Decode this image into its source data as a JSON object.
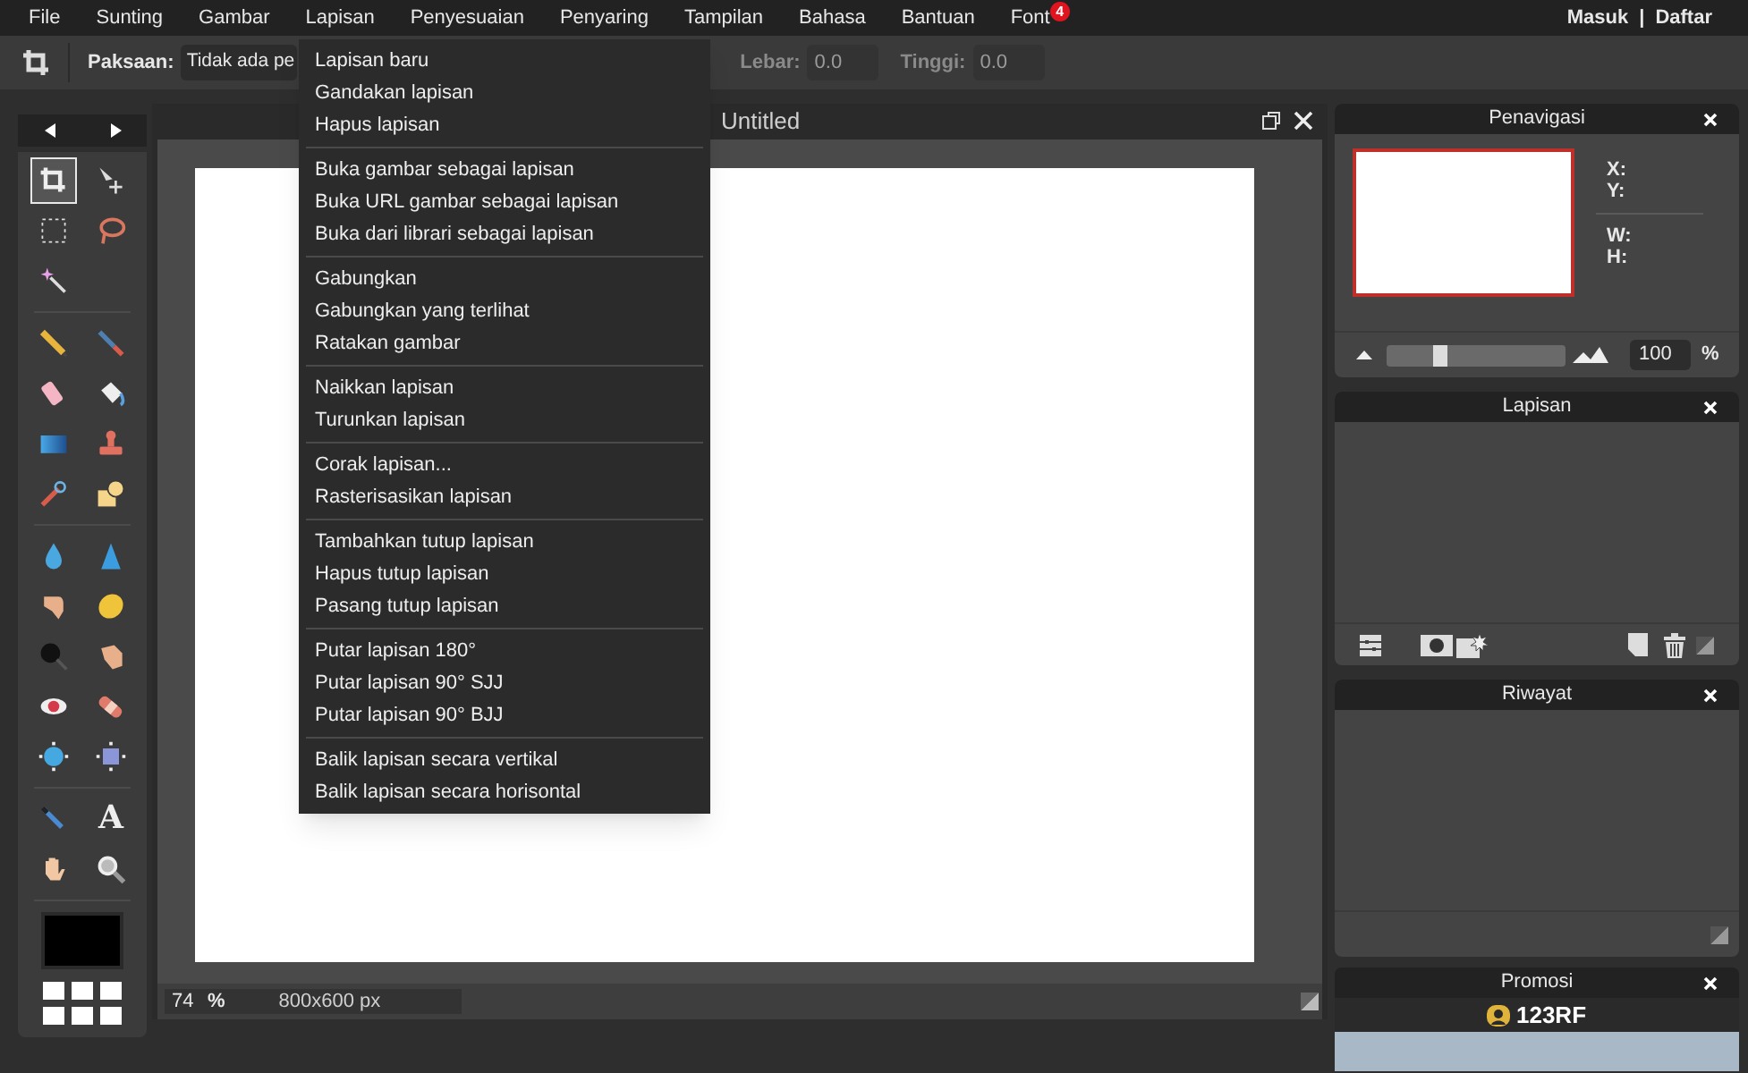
{
  "menu_bar": {
    "items": [
      {
        "label": "File"
      },
      {
        "label": "Sunting"
      },
      {
        "label": "Gambar"
      },
      {
        "label": "Lapisan"
      },
      {
        "label": "Penyesuaian"
      },
      {
        "label": "Penyaring"
      },
      {
        "label": "Tampilan"
      },
      {
        "label": "Bahasa"
      },
      {
        "label": "Bantuan"
      },
      {
        "label": "Font",
        "badge": "4"
      }
    ],
    "account": {
      "login": "Masuk",
      "separator": "|",
      "register": "Daftar"
    }
  },
  "options_bar": {
    "constraint_label": "Paksaan:",
    "constraint_value": "Tidak ada pe",
    "width_label": "Lebar:",
    "width_value": "0.0",
    "height_label": "Tinggi:",
    "height_value": "0.0"
  },
  "layer_menu": {
    "groups": [
      [
        "Lapisan baru",
        "Gandakan lapisan",
        "Hapus lapisan"
      ],
      [
        "Buka gambar sebagai lapisan",
        "Buka URL gambar sebagai lapisan",
        "Buka dari librari sebagai lapisan"
      ],
      [
        "Gabungkan",
        "Gabungkan yang terlihat",
        "Ratakan gambar"
      ],
      [
        "Naikkan lapisan",
        "Turunkan lapisan"
      ],
      [
        "Corak lapisan...",
        "Rasterisasikan lapisan"
      ],
      [
        "Tambahkan tutup lapisan",
        "Hapus tutup lapisan",
        "Pasang tutup lapisan"
      ],
      [
        "Putar lapisan 180°",
        "Putar lapisan 90° SJJ",
        "Putar lapisan 90° BJJ"
      ],
      [
        "Balik lapisan secara vertikal",
        "Balik lapisan secara horisontal"
      ]
    ]
  },
  "toolbox": {
    "groups": [
      [
        {
          "selected": true
        },
        {
          "selected": false
        },
        {
          "selected": false
        },
        {
          "selected": false
        },
        {
          "selected": false
        }
      ],
      [
        {
          "selected": false
        },
        {
          "selected": false
        },
        {
          "selected": false
        },
        {
          "selected": false
        },
        {
          "selected": false
        },
        {
          "selected": false
        },
        {
          "selected": false
        },
        {
          "selected": false
        }
      ],
      [
        {
          "selected": false
        },
        {
          "selected": false
        },
        {
          "selected": false
        },
        {
          "selected": false
        },
        {
          "selected": false
        },
        {
          "selected": false
        },
        {
          "selected": false
        },
        {
          "selected": false
        },
        {
          "selected": false
        },
        {
          "selected": false
        }
      ],
      [
        {
          "selected": false
        },
        {
          "selected": false,
          "glyph": "A"
        },
        {
          "selected": false
        },
        {
          "selected": false
        }
      ]
    ],
    "color": "#000000"
  },
  "document": {
    "title": "Untitled",
    "zoom": "74",
    "zoom_unit": "%",
    "size": "800x600 px"
  },
  "navigator": {
    "title": "Penavigasi",
    "labels": [
      "X:",
      "Y:",
      "W:",
      "H:"
    ],
    "level": 0.3,
    "zoom_value": "100",
    "zoom_unit": "%"
  },
  "layers_panel": {
    "title": "Lapisan"
  },
  "history_panel": {
    "title": "Riwayat"
  },
  "promo_panel": {
    "title": "Promosi",
    "logo": "123RF"
  }
}
